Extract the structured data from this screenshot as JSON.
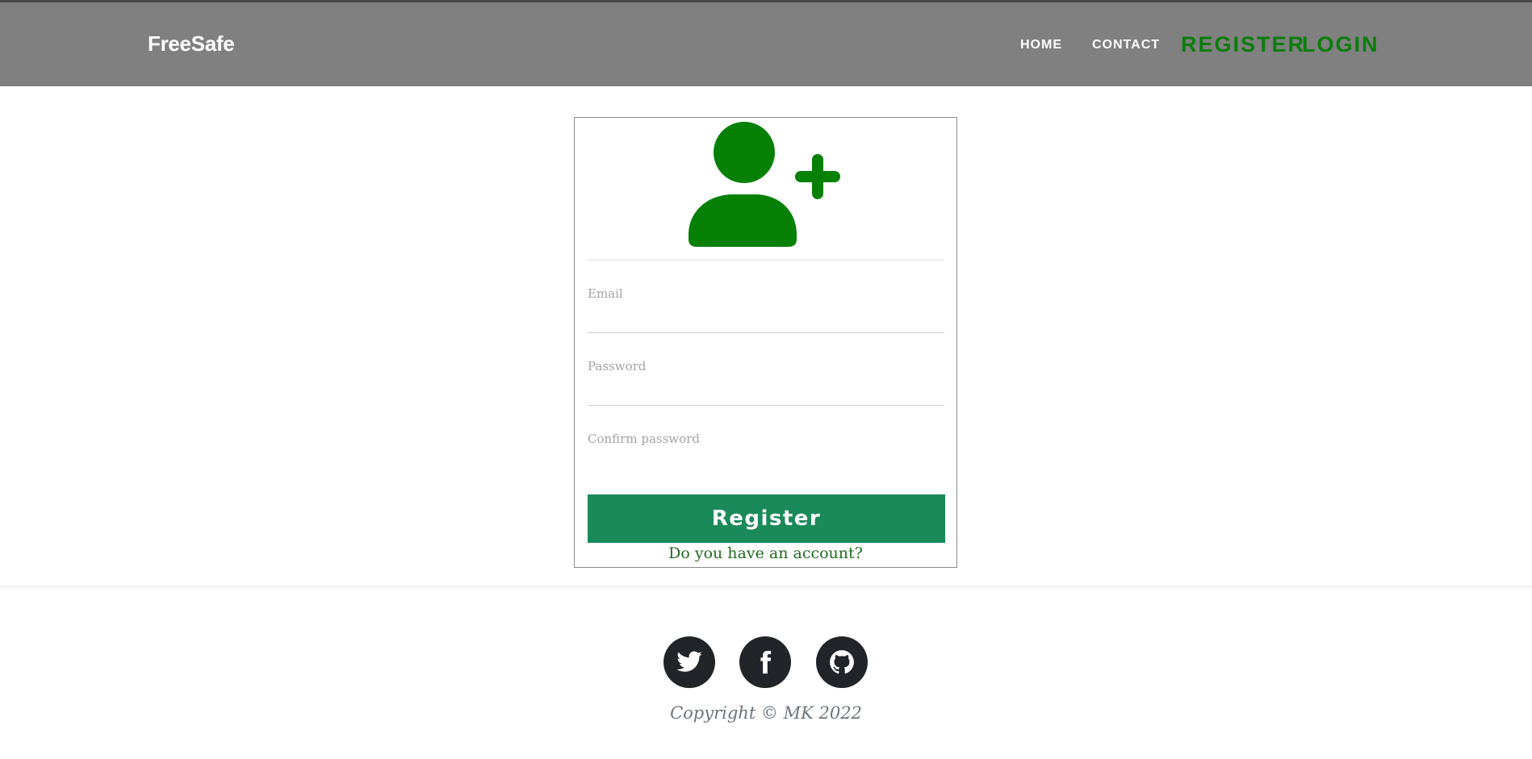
{
  "navbar": {
    "brand": "FreeSafe",
    "links": {
      "home": "HOME",
      "contact": "CONTACT",
      "register": "REGISTER",
      "login": "LOGIN"
    },
    "accent_color": "#0a7d0a",
    "background_color": "#808080"
  },
  "register_form": {
    "icon": "user-plus-icon",
    "fields": {
      "email": {
        "placeholder": "Email",
        "value": ""
      },
      "password": {
        "placeholder": "Password",
        "value": ""
      },
      "confirm_password": {
        "placeholder": "Confirm password",
        "value": ""
      }
    },
    "submit_label": "Register",
    "account_link": "Do you have an account?",
    "button_color": "#1a8a5a"
  },
  "footer": {
    "social": [
      "twitter-icon",
      "facebook-icon",
      "github-icon"
    ],
    "copyright": "Copyright © MK 2022"
  }
}
